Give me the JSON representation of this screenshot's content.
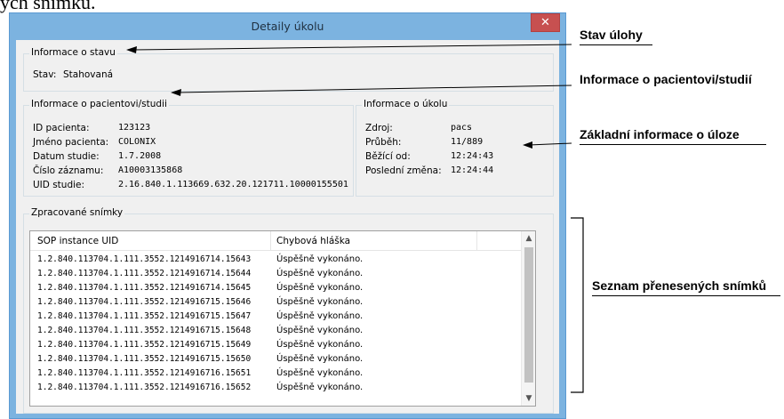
{
  "doc_fragment": "ych snímků.",
  "window": {
    "title": "Detaily úkolu",
    "close_label": "✕"
  },
  "status_group": {
    "title": "Informace o stavu",
    "status_label": "Stav:",
    "status_value": "Stahovaná"
  },
  "patient_group": {
    "title": "Informace o pacientovi/studii",
    "fields": [
      {
        "label": "ID pacienta:",
        "value": "123123"
      },
      {
        "label": "Jméno pacienta:",
        "value": "COLONIX"
      },
      {
        "label": "Datum studie:",
        "value": "1.7.2008"
      },
      {
        "label": "Číslo záznamu:",
        "value": "A10003135868"
      },
      {
        "label": "UID studie:",
        "value": "2.16.840.1.113669.632.20.121711.10000155501"
      }
    ]
  },
  "task_group": {
    "title": "Informace o úkolu",
    "fields": [
      {
        "label": "Zdroj:",
        "value": "pacs"
      },
      {
        "label": "Průběh:",
        "value": "11/889"
      },
      {
        "label": "Běžící od:",
        "value": "12:24:43"
      },
      {
        "label": "Poslední změna:",
        "value": "12:24:44"
      }
    ]
  },
  "images_group": {
    "title": "Zpracované snímky",
    "columns": [
      "SOP instance UID",
      "Chybová hláška"
    ],
    "rows": [
      {
        "uid": "1.2.840.113704.1.111.3552.1214916714.15643",
        "msg": "Úspěšně vykonáno."
      },
      {
        "uid": "1.2.840.113704.1.111.3552.1214916714.15644",
        "msg": "Úspěšně vykonáno."
      },
      {
        "uid": "1.2.840.113704.1.111.3552.1214916714.15645",
        "msg": "Úspěšně vykonáno."
      },
      {
        "uid": "1.2.840.113704.1.111.3552.1214916715.15646",
        "msg": "Úspěšně vykonáno."
      },
      {
        "uid": "1.2.840.113704.1.111.3552.1214916715.15647",
        "msg": "Úspěšně vykonáno."
      },
      {
        "uid": "1.2.840.113704.1.111.3552.1214916715.15648",
        "msg": "Úspěšně vykonáno."
      },
      {
        "uid": "1.2.840.113704.1.111.3552.1214916715.15649",
        "msg": "Úspěšně vykonáno."
      },
      {
        "uid": "1.2.840.113704.1.111.3552.1214916715.15650",
        "msg": "Úspěšně vykonáno."
      },
      {
        "uid": "1.2.840.113704.1.111.3552.1214916716.15651",
        "msg": "Úspěšně vykonáno."
      },
      {
        "uid": "1.2.840.113704.1.111.3552.1214916716.15652",
        "msg": "Úspěšně vykonáno."
      }
    ]
  },
  "annotations": {
    "status": "Stav úlohy",
    "patient": "Informace o pacientovi/studií",
    "task": "Základní informace o úloze",
    "images": "Seznam přenesených snímků"
  },
  "icons": {
    "close": "close-icon",
    "scroll_up": "scroll-up-icon",
    "scroll_down": "scroll-down-icon"
  },
  "colors": {
    "window_frame": "#7cb3e0",
    "close_button": "#c75050",
    "client_bg": "#f0f0f0"
  }
}
